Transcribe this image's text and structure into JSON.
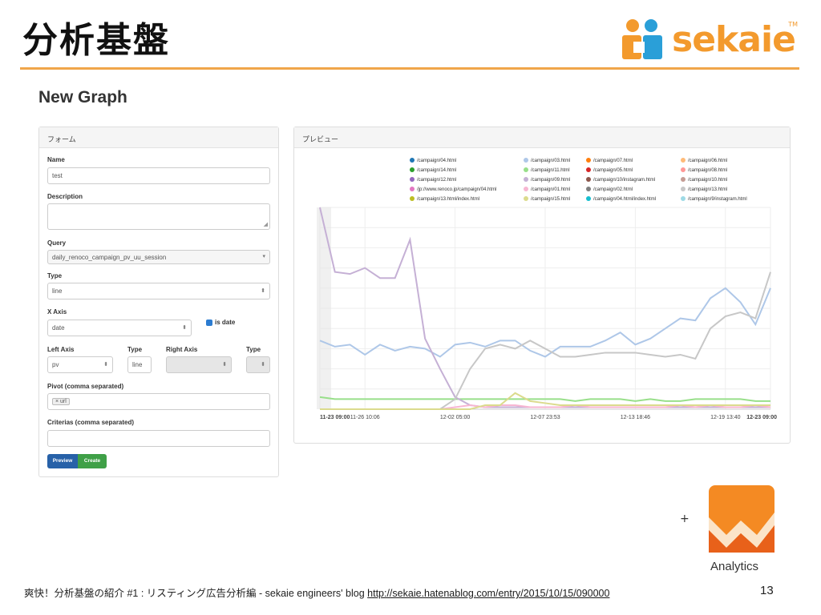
{
  "slide": {
    "title": "分析基盤",
    "logo_text": "sekaie",
    "logo_tm": "TM",
    "plus": "+",
    "analytics_label": "Analytics",
    "page_number": "13",
    "footer_text": "爽快！分析基盤の紹介 #1 : リスティング広告分析編 - sekaie engineers' blog",
    "footer_link": "http://sekaie.hatenablog.com/entry/2015/10/15/090000",
    "colors": {
      "accent": "#f0a64a",
      "logo": "#f39a2d",
      "logo_people": "#2a9fd8",
      "analytics": "#f48a23"
    }
  },
  "app": {
    "title": "New Graph",
    "form": {
      "heading": "フォーム",
      "name_label": "Name",
      "name_value": "test",
      "description_label": "Description",
      "description_value": "",
      "query_label": "Query",
      "query_value": "daily_renoco_campaign_pv_uu_session",
      "type_label": "Type",
      "type_value": "line",
      "xaxis_label": "X Axis",
      "xaxis_value": "date",
      "is_date_label": "is date",
      "left_axis_label": "Left Axis",
      "left_axis_value": "pv",
      "left_type_label": "Type",
      "left_type_value": "line",
      "right_axis_label": "Right Axis",
      "right_axis_value": "",
      "right_type_label": "Type",
      "right_type_value": "",
      "pivot_label": "Pivot (comma separated)",
      "pivot_tag": "× url",
      "criterias_label": "Criterias (comma separated)",
      "criterias_value": "",
      "preview_button": "Preview",
      "create_button": "Create"
    },
    "preview": {
      "heading": "プレビュー"
    }
  },
  "chart_data": {
    "type": "line",
    "x": [
      "11-23 09:00",
      "11-24",
      "11-25",
      "11-26 10:06",
      "11-27",
      "11-28",
      "11-29",
      "11-30",
      "12-01",
      "12-02 05:00",
      "12-03",
      "12-04",
      "12-05",
      "12-06",
      "12-07 23:53",
      "12-08",
      "12-09",
      "12-10",
      "12-11",
      "12-12",
      "12-13 18:46",
      "12-14",
      "12-15",
      "12-16",
      "12-17",
      "12-18",
      "12-19 13:40",
      "12-20",
      "12-21",
      "12-22",
      "12-23 09:00"
    ],
    "tick_labels": [
      "11-23 09:00",
      "11-26 10:06",
      "12-02 05:00",
      "12-07 23:53",
      "12-13 18:46",
      "12-19 13:40",
      "12-23 09:00"
    ],
    "tick_index": [
      0,
      3,
      9,
      15,
      21,
      27,
      30
    ],
    "ylim": [
      0,
      100
    ],
    "grid": true,
    "legend_position": "top",
    "series": [
      {
        "name": "/campaign/04.html",
        "color": "#1f77b4",
        "values": []
      },
      {
        "name": "/campaign/03.html",
        "color": "#aec7e8",
        "values": [
          34,
          31,
          32,
          27,
          32,
          29,
          31,
          30,
          26,
          32,
          33,
          31,
          34,
          34,
          29,
          26,
          31,
          31,
          31,
          34,
          38,
          32,
          35,
          40,
          45,
          44,
          55,
          60,
          53,
          42,
          60
        ]
      },
      {
        "name": "/campaign/07.html",
        "color": "#ff7f0e",
        "values": []
      },
      {
        "name": "/campaign/06.html",
        "color": "#ffbb78",
        "values": []
      },
      {
        "name": "/campaign/14.html",
        "color": "#2ca02c",
        "values": []
      },
      {
        "name": "/campaign/11.html",
        "color": "#98df8a",
        "values": [
          6,
          5,
          5,
          5,
          5,
          5,
          5,
          5,
          5,
          5,
          5,
          5,
          5,
          5,
          5,
          5,
          5,
          4,
          5,
          5,
          5,
          4,
          5,
          4,
          4,
          5,
          5,
          5,
          5,
          4,
          4
        ]
      },
      {
        "name": "/campaign/05.html",
        "color": "#d62728",
        "values": []
      },
      {
        "name": "/campaign/08.html",
        "color": "#ff9896",
        "values": []
      },
      {
        "name": "/campaign/12.html",
        "color": "#9467bd",
        "values": []
      },
      {
        "name": "/campaign/09.html",
        "color": "#c5b0d5",
        "values": [
          100,
          68,
          67,
          70,
          65,
          65,
          84,
          35,
          20,
          6,
          2,
          1,
          1,
          1,
          1,
          1,
          1,
          1,
          1,
          1,
          1,
          1,
          1,
          1,
          1,
          1,
          1,
          1,
          1,
          1,
          1
        ]
      },
      {
        "name": "/campaign/10/instagram.html",
        "color": "#8c564b",
        "values": []
      },
      {
        "name": "/campaign/10.html",
        "color": "#c49c94",
        "values": []
      },
      {
        "name": "/jp://www.renoco.jp/campaign/04.html",
        "color": "#e377c2",
        "values": []
      },
      {
        "name": "/campaign/01.html",
        "color": "#f7b6d2",
        "values": [
          0,
          0,
          0,
          0,
          0,
          0,
          0,
          0,
          0,
          1,
          2,
          1,
          2,
          2,
          1,
          1,
          1,
          2,
          1,
          1,
          1,
          1,
          1,
          1,
          2,
          1,
          2,
          1,
          1,
          2,
          1
        ]
      },
      {
        "name": "/campaign/02.html",
        "color": "#7f7f7f",
        "values": []
      },
      {
        "name": "/campaign/13.html",
        "color": "#c7c7c7",
        "values": [
          0,
          0,
          0,
          0,
          0,
          0,
          0,
          0,
          0,
          5,
          20,
          30,
          32,
          30,
          34,
          30,
          26,
          26,
          27,
          28,
          28,
          28,
          27,
          26,
          27,
          25,
          40,
          46,
          48,
          45,
          68
        ]
      },
      {
        "name": "/campaign/13.html/index.html",
        "color": "#bcbd22",
        "values": []
      },
      {
        "name": "/campaign/15.html",
        "color": "#dbdb8d",
        "values": [
          0,
          0,
          0,
          0,
          0,
          0,
          0,
          0,
          0,
          0,
          0,
          2,
          2,
          8,
          4,
          3,
          2,
          2,
          2,
          2,
          2,
          2,
          2,
          2,
          2,
          2,
          2,
          2,
          2,
          2,
          2
        ]
      },
      {
        "name": "/campaign/04.html/index.html",
        "color": "#17becf",
        "values": []
      },
      {
        "name": "/campaign/9/instagram.html",
        "color": "#9edae5",
        "values": []
      }
    ]
  }
}
